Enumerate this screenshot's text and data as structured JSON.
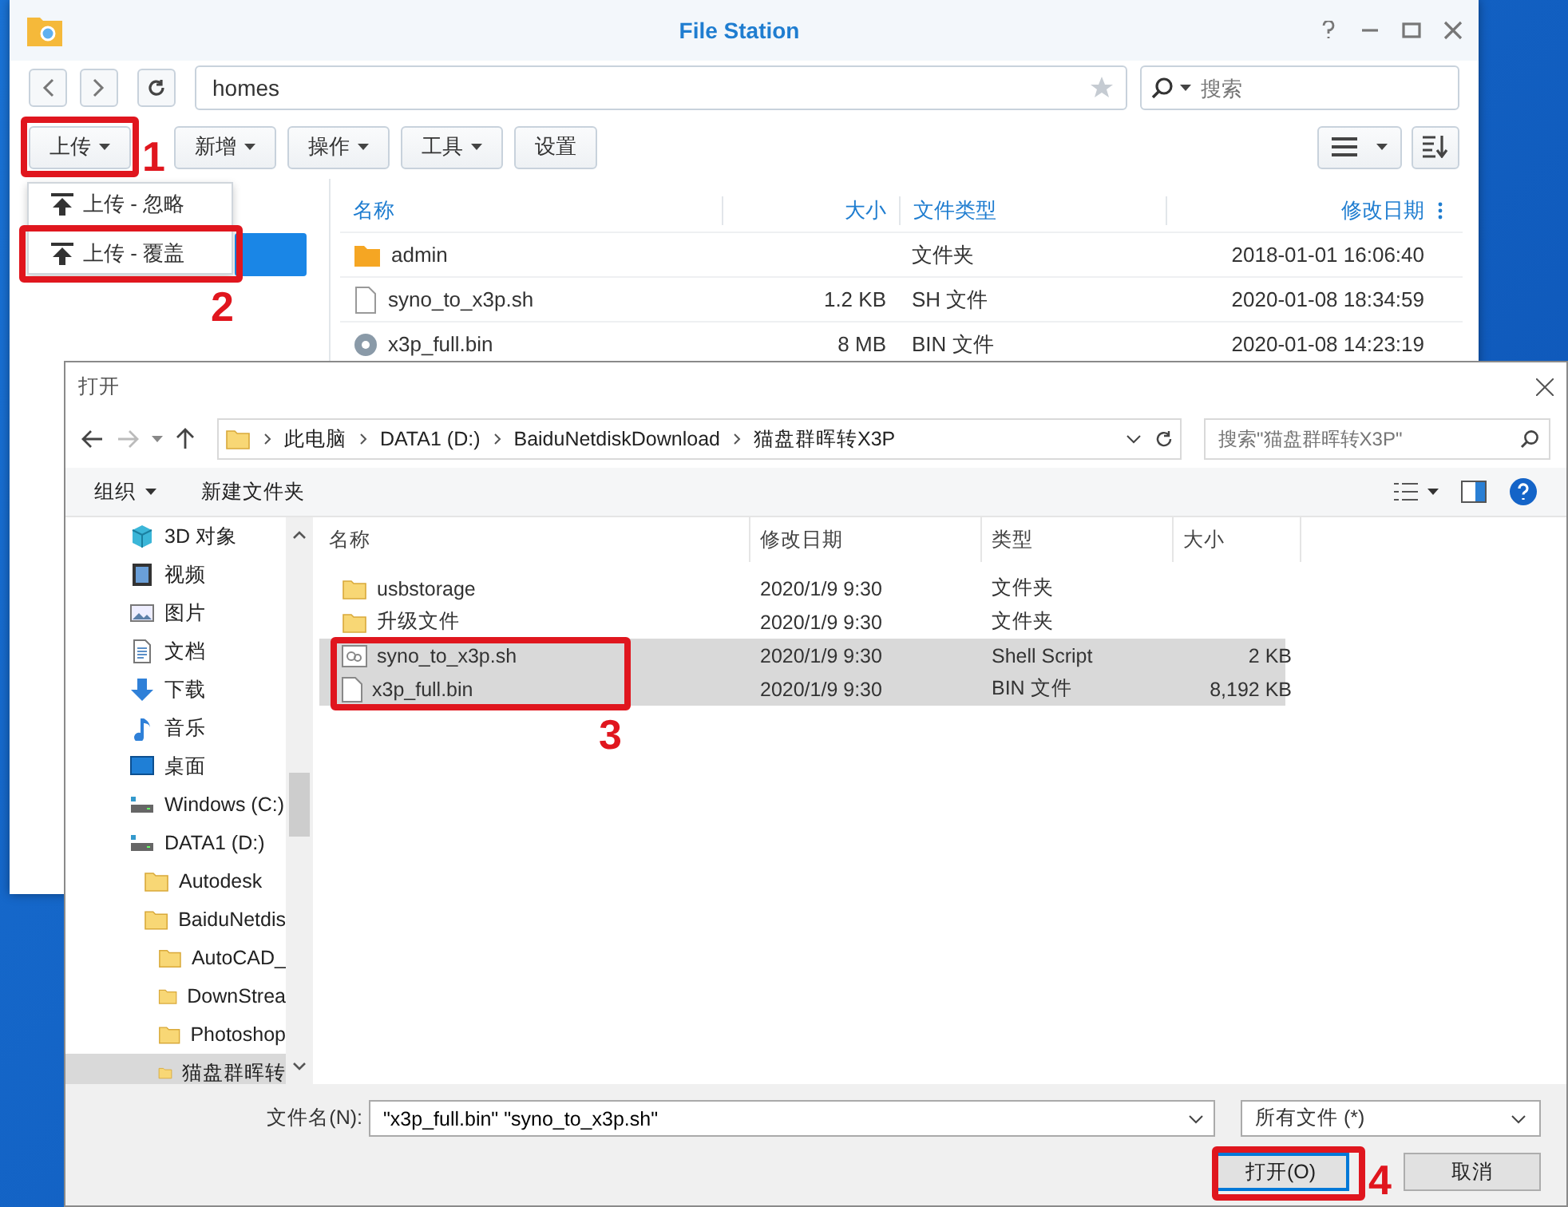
{
  "file_station": {
    "title": "File Station",
    "path": "homes",
    "search": {
      "placeholder": "搜索"
    },
    "toolbar": [
      {
        "label": "上传",
        "dropdown": true
      },
      {
        "label": "新增",
        "dropdown": true
      },
      {
        "label": "操作",
        "dropdown": true
      },
      {
        "label": "工具",
        "dropdown": true
      },
      {
        "label": "设置",
        "dropdown": false
      }
    ],
    "upload_menu": [
      "上传 - 忽略",
      "上传 - 覆盖"
    ],
    "columns": [
      "名称",
      "大小",
      "文件类型",
      "修改日期"
    ],
    "rows": [
      {
        "kind": "folder",
        "name": "admin",
        "type": "文件夹",
        "modified": "2018-01-01 16:06:40"
      },
      {
        "kind": "script",
        "name": "syno_to_x3p.sh",
        "size": "1.2 KB",
        "type": "SH 文件",
        "modified": "2020-01-08 18:34:59"
      },
      {
        "kind": "disc",
        "name": "x3p_full.bin",
        "size": "8 MB",
        "type": "BIN 文件",
        "modified": "2020-01-08 14:23:19"
      }
    ]
  },
  "open_dialog": {
    "title": "打开",
    "breadcrumb": [
      "此电脑",
      "DATA1 (D:)",
      "BaiduNetdiskDownload",
      "猫盘群晖转X3P"
    ],
    "search": {
      "placeholder": "搜索\"猫盘群晖转X3P\""
    },
    "toolbar": [
      {
        "label": "组织",
        "dropdown": true
      },
      {
        "label": "新建文件夹",
        "dropdown": false
      }
    ],
    "sidebar": [
      {
        "kind": "cube",
        "label": "3D 对象",
        "selected": false
      },
      {
        "kind": "video",
        "label": "视频",
        "selected": false
      },
      {
        "kind": "picture",
        "label": "图片",
        "selected": false
      },
      {
        "kind": "document",
        "label": "文档",
        "selected": false
      },
      {
        "kind": "download",
        "label": "下载",
        "selected": false
      },
      {
        "kind": "music",
        "label": "音乐",
        "selected": false
      },
      {
        "kind": "desktop",
        "label": "桌面",
        "selected": false
      },
      {
        "kind": "drive",
        "label": "Windows (C:)",
        "selected": false
      },
      {
        "kind": "drive",
        "label": "DATA1 (D:)",
        "selected": false,
        "children": [
          {
            "kind": "folder",
            "label": "Autodesk",
            "selected": false
          },
          {
            "kind": "folder",
            "label": "BaiduNetdis",
            "selected": false,
            "children": [
              {
                "kind": "folder",
                "label": "AutoCAD_",
                "selected": false
              },
              {
                "kind": "folder",
                "label": "DownStrea",
                "selected": false
              },
              {
                "kind": "folder",
                "label": "Photoshop",
                "selected": false
              },
              {
                "kind": "folder",
                "label": "猫盘群晖转",
                "selected": true
              }
            ]
          }
        ]
      }
    ],
    "columns": [
      "名称",
      "修改日期",
      "类型",
      "大小"
    ],
    "rows": [
      {
        "kind": "folder",
        "name": "usbstorage",
        "modified": "2020/1/9 9:30",
        "type": "文件夹",
        "selected": false
      },
      {
        "kind": "folder",
        "name": "升级文件",
        "modified": "2020/1/9 9:30",
        "type": "文件夹",
        "selected": false
      },
      {
        "kind": "script",
        "name": "syno_to_x3p.sh",
        "modified": "2020/1/9 9:30",
        "type": "Shell Script",
        "size": "2 KB",
        "selected": true
      },
      {
        "kind": "file",
        "name": "x3p_full.bin",
        "modified": "2020/1/9 9:30",
        "type": "BIN 文件",
        "size": "8,192 KB",
        "selected": true
      }
    ],
    "filename_label": "文件名(N):",
    "filename": "\"x3p_full.bin\" \"syno_to_x3p.sh\"",
    "filetype": "所有文件 (*)",
    "buttons": [
      {
        "label": "打开(O)",
        "kind": "primary"
      },
      {
        "label": "取消",
        "kind": "normal"
      }
    ]
  },
  "annotations": [
    {
      "label": "1"
    },
    {
      "label": "2"
    },
    {
      "label": "3"
    },
    {
      "label": "4"
    }
  ]
}
